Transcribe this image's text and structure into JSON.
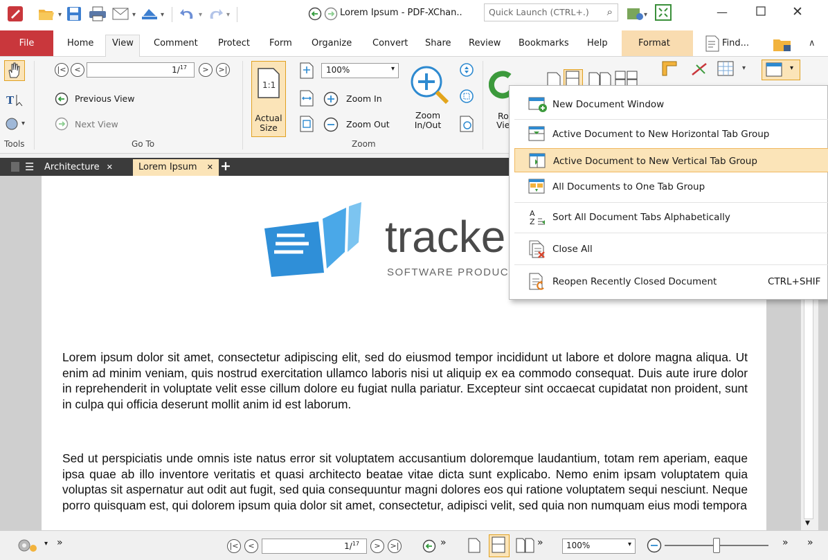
{
  "title_bar": {
    "title": "Lorem Ipsum - PDF-XChan..",
    "quick_launch_placeholder": "Quick Launch (CTRL+.)"
  },
  "ribbon_tabs": [
    "File",
    "Home",
    "View",
    "Comment",
    "Protect",
    "Form",
    "Organize",
    "Convert",
    "Share",
    "Review",
    "Bookmarks",
    "Help",
    "Format"
  ],
  "find_label": "Find...",
  "ribbon": {
    "tools_label": "Tools",
    "goto_label": "Go To",
    "zoom_label": "Zoom",
    "page_field": "1/",
    "page_total": "17",
    "previous_view": "Previous View",
    "next_view": "Next View",
    "actual_size": [
      "Actual",
      "Size"
    ],
    "zoom_value": "100%",
    "zoom_in": "Zoom In",
    "zoom_out": "Zoom Out",
    "zoom_inout": [
      "Zoom",
      "In/Out"
    ],
    "ro_partial": "Ro",
    "vie_partial": "Vie"
  },
  "doc_tabs": [
    {
      "label": "Architecture",
      "active": false
    },
    {
      "label": "Lorem Ipsum",
      "active": true
    }
  ],
  "document": {
    "logo_text": "tracke",
    "logo_sub": "SOFTWARE PRODUC",
    "paragraph1": "Lorem ipsum dolor sit amet, consectetur adipiscing elit, sed do eiusmod tempor incididunt ut labore et dolore magna aliqua. Ut enim ad minim veniam, quis nostrud exercitation ullamco laboris nisi ut aliquip ex ea commodo consequat. Duis aute irure dolor in reprehenderit in voluptate velit esse cillum dolore eu fugiat nulla pariatur. Excepteur sint occaecat cupidatat non proident, sunt in culpa qui officia deserunt mollit anim id est laborum.",
    "paragraph2": "Sed ut perspiciatis unde omnis iste natus error sit voluptatem accusantium doloremque laudantium, totam rem aperiam, eaque ipsa quae ab illo inventore veritatis et quasi architecto beatae vitae dicta sunt explicabo. Nemo enim ipsam voluptatem quia voluptas sit aspernatur aut odit aut fugit, sed quia consequuntur magni dolores eos qui ratione voluptatem sequi nesciunt. Neque porro quisquam est, qui dolorem ipsum quia dolor sit amet, consectetur, adipisci velit, sed quia non numquam eius modi tempora"
  },
  "menu": {
    "items": [
      {
        "label": "New Document Window",
        "icon": "new-window-icon",
        "highlighted": false,
        "shortcut": ""
      },
      {
        "label": "Active Document to New Horizontal Tab Group",
        "icon": "horizontal-group-icon",
        "highlighted": false,
        "shortcut": ""
      },
      {
        "label": "Active Document to New Vertical Tab Group",
        "icon": "vertical-group-icon",
        "highlighted": true,
        "shortcut": ""
      },
      {
        "label": "All Documents to One Tab Group",
        "icon": "one-group-icon",
        "highlighted": false,
        "shortcut": ""
      },
      {
        "label": "Sort All Document Tabs Alphabetically",
        "icon": "sort-az-icon",
        "highlighted": false,
        "shortcut": ""
      },
      {
        "label": "Close All",
        "icon": "close-all-icon",
        "highlighted": false,
        "shortcut": ""
      },
      {
        "label": "Reopen Recently Closed Document",
        "icon": "reopen-icon",
        "highlighted": false,
        "shortcut": "CTRL+SHIF"
      }
    ]
  },
  "status_bar": {
    "page_field": "1/",
    "page_total": "17",
    "zoom_value": "100%",
    "zoom_slider_level": 0.5
  },
  "colors": {
    "file_tab": "#c9373c",
    "format_tab": "#f9dcb0",
    "menu_highlight": "#fbe4b8",
    "active_doc_tab": "#fbe4b8",
    "accent_green": "#3c9a3c",
    "logo_blue": "#2f8fd8"
  }
}
